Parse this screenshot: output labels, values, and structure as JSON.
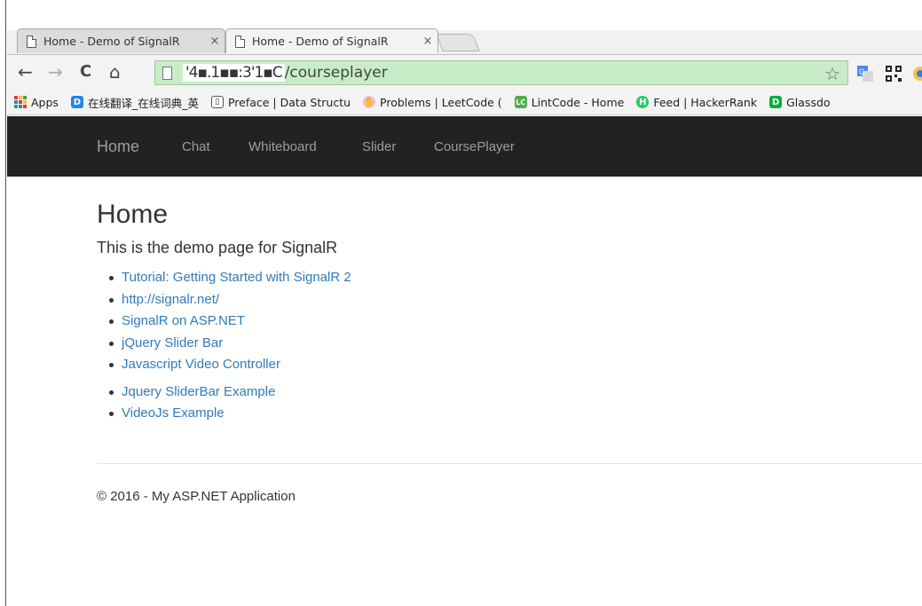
{
  "browser": {
    "tabs": [
      {
        "title": "Home - Demo of SignalR",
        "close": "×",
        "active": false
      },
      {
        "title": "Home - Demo of SignalR",
        "close": "×",
        "active": true
      }
    ],
    "nav": {
      "back": "←",
      "forward": "→",
      "reload": "C",
      "home": "⌂"
    },
    "url": {
      "host": "'4▪.1▪▪:3'1▪C",
      "path": "/courseplayer"
    },
    "bookmark_star": "☆",
    "bookmarks": [
      {
        "label": "Apps",
        "icon": "apps-grid-icon"
      },
      {
        "label": "在线翻译_在线词典_英",
        "icon": "D",
        "color": "#1e88e5"
      },
      {
        "label": "Preface | Data Structu",
        "icon": "book-icon"
      },
      {
        "label": "Problems | LeetCode (",
        "icon": "hand-icon"
      },
      {
        "label": "LintCode - Home",
        "icon": "LC",
        "color": "#4caf50"
      },
      {
        "label": "Feed | HackerRank",
        "icon": "H",
        "color": "#2ec866"
      },
      {
        "label": "Glassdo",
        "icon": "D",
        "color": "#0caa41"
      }
    ]
  },
  "site": {
    "brand": "Home",
    "nav": [
      "Chat",
      "Whiteboard",
      "Slider",
      "CoursePlayer"
    ],
    "title": "Home",
    "lead": "This is the demo page for SignalR",
    "links1": [
      "Tutorial: Getting Started with SignalR 2",
      "http://signalr.net/",
      "SignalR on ASP.NET",
      "jQuery Slider Bar",
      "Javascript Video Controller"
    ],
    "links2": [
      "Jquery SliderBar Example",
      "VideoJs Example"
    ],
    "footer": "© 2016 - My ASP.NET Application"
  },
  "colors": {
    "navbar": "#222222",
    "link": "#337ab7",
    "omnibox": "#c8ecc8"
  }
}
